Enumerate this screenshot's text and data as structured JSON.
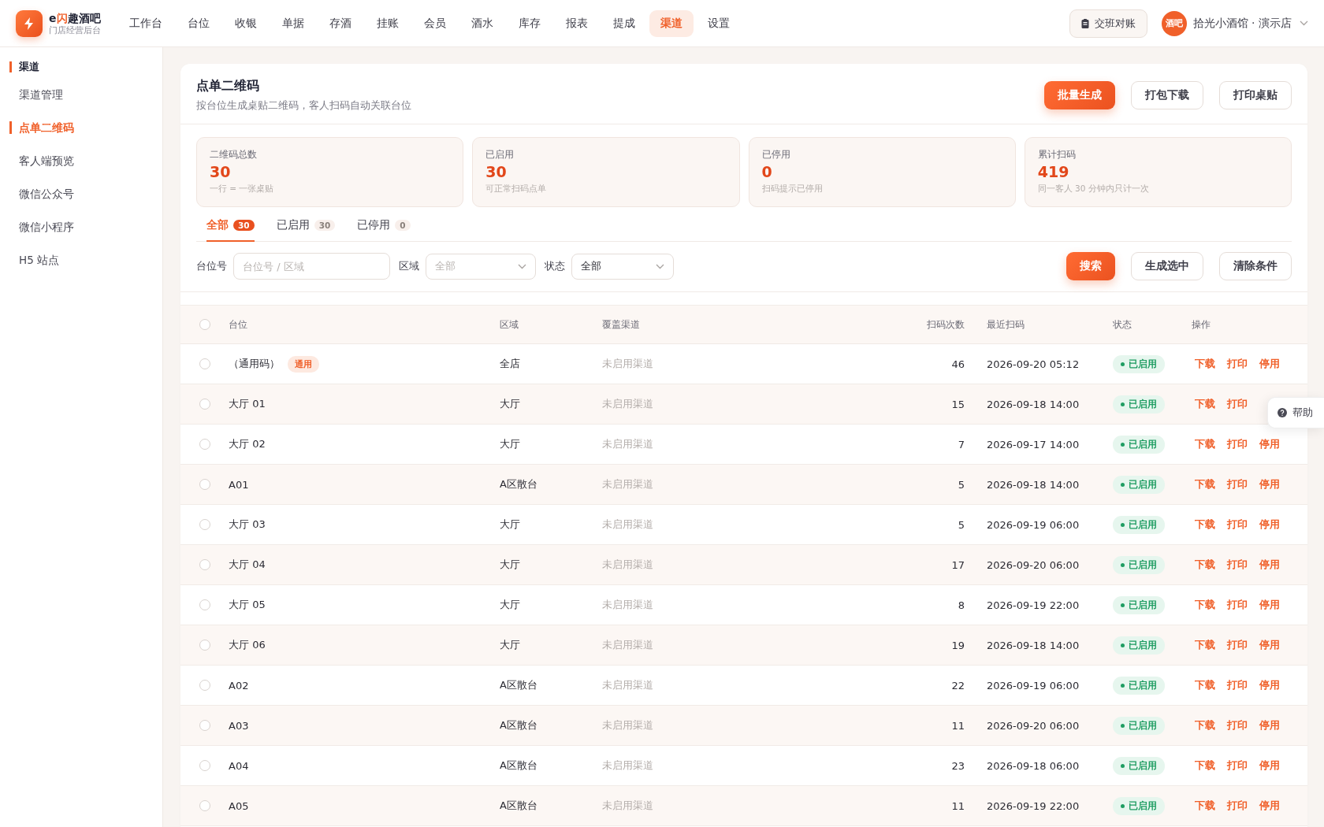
{
  "brand": {
    "name_prefix": "e",
    "name_highlight": "闪",
    "name_rest": "趣酒吧",
    "subtitle": "门店经营后台"
  },
  "nav": [
    {
      "label": "工作台",
      "selected": false
    },
    {
      "label": "台位",
      "selected": false
    },
    {
      "label": "收银",
      "selected": false
    },
    {
      "label": "单据",
      "selected": false
    },
    {
      "label": "存酒",
      "selected": false
    },
    {
      "label": "挂账",
      "selected": false
    },
    {
      "label": "会员",
      "selected": false
    },
    {
      "label": "酒水",
      "selected": false
    },
    {
      "label": "库存",
      "selected": false
    },
    {
      "label": "报表",
      "selected": false
    },
    {
      "label": "提成",
      "selected": false
    },
    {
      "label": "渠道",
      "selected": true
    },
    {
      "label": "设置",
      "selected": false
    }
  ],
  "shift_button": "交班对账",
  "store": {
    "avatar": "酒吧",
    "name": "拾光小酒馆 · 演示店"
  },
  "sidebar": {
    "section": "渠道",
    "items": [
      {
        "label": "渠道管理",
        "selected": false
      },
      {
        "label": "点单二维码",
        "selected": true
      },
      {
        "label": "客人端预览",
        "selected": false
      },
      {
        "label": "微信公众号",
        "selected": false
      },
      {
        "label": "微信小程序",
        "selected": false
      },
      {
        "label": "H5 站点",
        "selected": false
      }
    ]
  },
  "page": {
    "title": "点单二维码",
    "subtitle": "按台位生成桌贴二维码，客人扫码自动关联台位",
    "actions": [
      {
        "label": "批量生成",
        "kind": "primary"
      },
      {
        "label": "打包下载",
        "kind": "default"
      },
      {
        "label": "打印桌贴",
        "kind": "default"
      }
    ]
  },
  "stats": [
    {
      "label": "二维码总数",
      "value": "30",
      "note": "一行 = 一张桌贴"
    },
    {
      "label": "已启用",
      "value": "30",
      "note": "可正常扫码点单"
    },
    {
      "label": "已停用",
      "value": "0",
      "note": "扫码提示已停用"
    },
    {
      "label": "累计扫码",
      "value": "419",
      "note": "同一客人 30 分钟内只计一次"
    }
  ],
  "tabs": [
    {
      "label": "全部",
      "count": "30",
      "selected": true
    },
    {
      "label": "已启用",
      "count": "30",
      "selected": false
    },
    {
      "label": "已停用",
      "count": "0",
      "selected": false
    }
  ],
  "filters": {
    "table_label": "台位号",
    "table_placeholder": "台位号 / 区域",
    "area_label": "区域",
    "area_placeholder": "全部",
    "status_label": "状态",
    "status_value": "全部",
    "buttons": [
      {
        "label": "搜索",
        "kind": "primary"
      },
      {
        "label": "生成选中",
        "kind": "default"
      },
      {
        "label": "清除条件",
        "kind": "default"
      }
    ]
  },
  "table": {
    "select_all_checked": false,
    "columns": [
      "台位",
      "区域",
      "覆盖渠道",
      "扫码次数",
      "最近扫码",
      "状态",
      "操作"
    ],
    "rows": [
      {
        "checked": false,
        "table": "（通用码）",
        "tag": "通用",
        "area": "全店",
        "channel": "未启用渠道",
        "scans": "46",
        "last": "2026-09-20 05:12",
        "status": "已启用",
        "enabled": true,
        "actions": [
          "下载",
          "打印",
          "停用"
        ]
      },
      {
        "checked": false,
        "table": "大厅 01",
        "area": "大厅",
        "channel": "未启用渠道",
        "scans": "15",
        "last": "2026-09-18 14:00",
        "status": "已启用",
        "enabled": true,
        "actions": [
          "下载",
          "打印"
        ]
      },
      {
        "checked": false,
        "table": "大厅 02",
        "area": "大厅",
        "channel": "未启用渠道",
        "scans": "7",
        "last": "2026-09-17 14:00",
        "status": "已启用",
        "enabled": true,
        "actions": [
          "下载",
          "打印",
          "停用"
        ]
      },
      {
        "checked": false,
        "table": "A01",
        "area": "A区散台",
        "channel": "未启用渠道",
        "scans": "5",
        "last": "2026-09-18 14:00",
        "status": "已启用",
        "enabled": true,
        "actions": [
          "下载",
          "打印",
          "停用"
        ]
      },
      {
        "checked": false,
        "table": "大厅 03",
        "area": "大厅",
        "channel": "未启用渠道",
        "scans": "5",
        "last": "2026-09-19 06:00",
        "status": "已启用",
        "enabled": true,
        "actions": [
          "下载",
          "打印",
          "停用"
        ]
      },
      {
        "checked": false,
        "table": "大厅 04",
        "area": "大厅",
        "channel": "未启用渠道",
        "scans": "17",
        "last": "2026-09-20 06:00",
        "status": "已启用",
        "enabled": true,
        "actions": [
          "下载",
          "打印",
          "停用"
        ]
      },
      {
        "checked": false,
        "table": "大厅 05",
        "area": "大厅",
        "channel": "未启用渠道",
        "scans": "8",
        "last": "2026-09-19 22:00",
        "status": "已启用",
        "enabled": true,
        "actions": [
          "下载",
          "打印",
          "停用"
        ]
      },
      {
        "checked": false,
        "table": "大厅 06",
        "area": "大厅",
        "channel": "未启用渠道",
        "scans": "19",
        "last": "2026-09-18 14:00",
        "status": "已启用",
        "enabled": true,
        "actions": [
          "下载",
          "打印",
          "停用"
        ]
      },
      {
        "checked": false,
        "table": "A02",
        "area": "A区散台",
        "channel": "未启用渠道",
        "scans": "22",
        "last": "2026-09-19 06:00",
        "status": "已启用",
        "enabled": true,
        "actions": [
          "下载",
          "打印",
          "停用"
        ]
      },
      {
        "checked": false,
        "table": "A03",
        "area": "A区散台",
        "channel": "未启用渠道",
        "scans": "11",
        "last": "2026-09-20 06:00",
        "status": "已启用",
        "enabled": true,
        "actions": [
          "下载",
          "打印",
          "停用"
        ]
      },
      {
        "checked": false,
        "table": "A04",
        "area": "A区散台",
        "channel": "未启用渠道",
        "scans": "23",
        "last": "2026-09-18 06:00",
        "status": "已启用",
        "enabled": true,
        "actions": [
          "下载",
          "打印",
          "停用"
        ]
      },
      {
        "checked": false,
        "table": "A05",
        "area": "A区散台",
        "channel": "未启用渠道",
        "scans": "11",
        "last": "2026-09-19 22:00",
        "status": "已启用",
        "enabled": true,
        "actions": [
          "下载",
          "打印",
          "停用"
        ]
      }
    ]
  },
  "help_button": "帮助"
}
